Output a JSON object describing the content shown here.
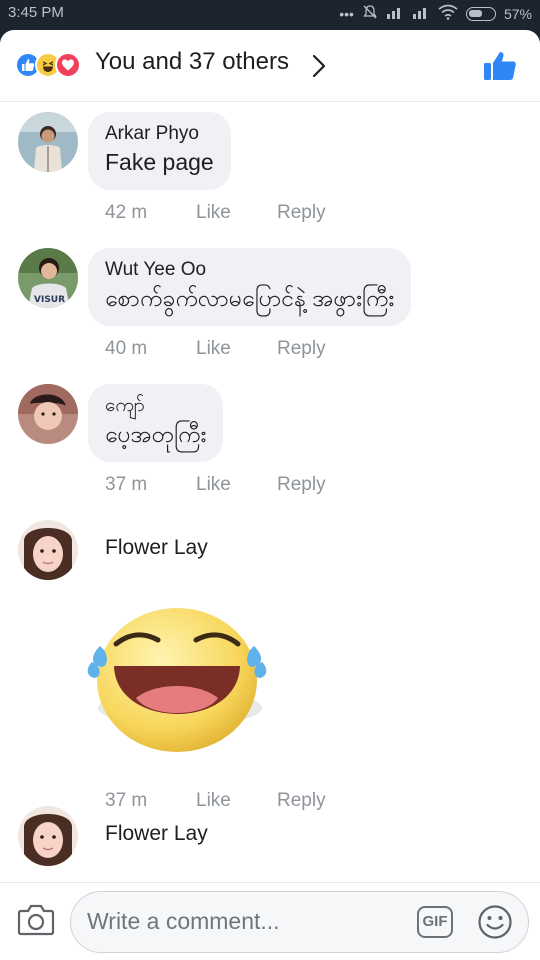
{
  "status_bar": {
    "time": "3:45 PM",
    "battery": "57%",
    "battery_level": 0.57
  },
  "header": {
    "reaction_icons": [
      "like-icon",
      "haha-icon",
      "love-icon"
    ],
    "reactions_text": "You and 37 others"
  },
  "comments": [
    {
      "name": "Arkar Phyo",
      "text": "Fake page",
      "time": "42 m",
      "like": "Like",
      "reply": "Reply"
    },
    {
      "name": "Wut Yee Oo",
      "text": "စောက်ခွက်လာမပြောင်နဲ့ အဖွားကြီး",
      "time": "40 m",
      "like": "Like",
      "reply": "Reply"
    },
    {
      "name": "ကျော်",
      "text": "ပေ့အတုကြီး",
      "time": "37 m",
      "like": "Like",
      "reply": "Reply"
    },
    {
      "name": "Flower Lay",
      "sticker": "laughing-tears-sticker",
      "time": "37 m",
      "like": "Like",
      "reply": "Reply"
    },
    {
      "name": "Flower Lay"
    }
  ],
  "composer": {
    "placeholder": "Write a comment...",
    "gif_label": "GIF"
  },
  "colors": {
    "accent": "#2f86f6",
    "bubble": "#f0f1f4",
    "meta": "#8f949b",
    "status_bg": "#1c2430"
  }
}
